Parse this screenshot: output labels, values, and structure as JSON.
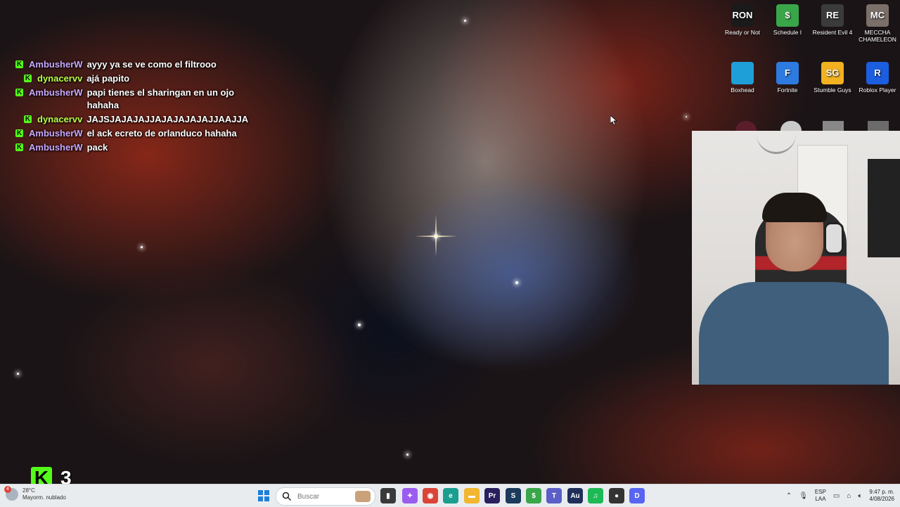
{
  "chat": [
    {
      "user": "AmbusherW",
      "user_color": "#c9a8ff",
      "text": "ayyy ya se ve como el filtrooo",
      "indent": false
    },
    {
      "user": "dynacervv",
      "user_color": "#b9ff4a",
      "text": "ajá papito",
      "indent": true
    },
    {
      "user": "AmbusherW",
      "user_color": "#c9a8ff",
      "text": "papi tienes el sharingan en un ojo hahaha",
      "indent": false
    },
    {
      "user": "dynacervv",
      "user_color": "#b9ff4a",
      "text": "JAJSJAJAJAJJAJAJAJAJAJJAAJJA",
      "indent": true
    },
    {
      "user": "AmbusherW",
      "user_color": "#c9a8ff",
      "text": "el ack ecreto de orlanduco hahaha",
      "indent": false
    },
    {
      "user": "AmbusherW",
      "user_color": "#c9a8ff",
      "text": "pack",
      "indent": false
    }
  ],
  "chat_badge": "K",
  "desktop_icons": [
    {
      "label": "Ready or Not",
      "glyph": "RON",
      "color": "#1a1a1a"
    },
    {
      "label": "Schedule I",
      "glyph": "$",
      "color": "#3aa64a"
    },
    {
      "label": "Resident Evil 4",
      "glyph": "RE",
      "color": "#3b3b3b"
    },
    {
      "label": "MECCHA CHAMELEON",
      "glyph": "MC",
      "color": "#7b6f6a"
    },
    {
      "label": "Boxhead",
      "glyph": "",
      "color": "#1f9fd8"
    },
    {
      "label": "Fortnite",
      "glyph": "F",
      "color": "#2d7be0"
    },
    {
      "label": "Stumble Guys",
      "glyph": "SG",
      "color": "#f2b120"
    },
    {
      "label": "Roblox Player",
      "glyph": "R",
      "color": "#1b5ee0"
    }
  ],
  "kick_overlay": {
    "logo": "K",
    "count": "3"
  },
  "taskbar": {
    "weather_badge": "4",
    "weather_temp": "28°C",
    "weather_text": "Mayorm. nublado",
    "search_placeholder": "Buscar",
    "apps": [
      {
        "name": "windows-start",
        "glyph": "⊞",
        "color": "#1d7fd8"
      },
      {
        "name": "file-explorer-doc",
        "glyph": "▮",
        "color": "#3a3a3a"
      },
      {
        "name": "copilot",
        "glyph": "✦",
        "color": "#9b5cf0"
      },
      {
        "name": "chrome",
        "glyph": "◉",
        "color": "#db4437"
      },
      {
        "name": "edge",
        "glyph": "e",
        "color": "#1a9e8f"
      },
      {
        "name": "folder",
        "glyph": "▬",
        "color": "#f2b630"
      },
      {
        "name": "premiere",
        "glyph": "Pr",
        "color": "#2a1f5e"
      },
      {
        "name": "steam",
        "glyph": "S",
        "color": "#1b3a5c"
      },
      {
        "name": "game-app",
        "glyph": "$",
        "color": "#3aa64a"
      },
      {
        "name": "teams",
        "glyph": "T",
        "color": "#5b5fc7"
      },
      {
        "name": "audition",
        "glyph": "Au",
        "color": "#1f2f5a"
      },
      {
        "name": "spotify",
        "glyph": "♫",
        "color": "#1db954"
      },
      {
        "name": "roblox-studio",
        "glyph": "●",
        "color": "#333333"
      },
      {
        "name": "discord",
        "glyph": "D",
        "color": "#5865f2"
      }
    ],
    "language_top": "ESP",
    "language_bottom": "LAA",
    "time": "9:47 p. m.",
    "date": "4/08/2026"
  }
}
